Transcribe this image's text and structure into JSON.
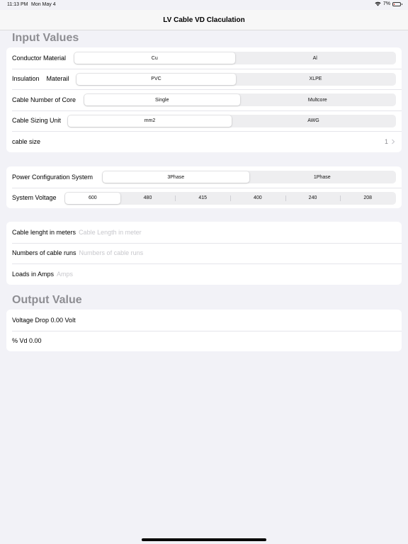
{
  "status": {
    "time": "11:13 PM",
    "date": "Mon May 4",
    "battery": "7%"
  },
  "nav": {
    "title": "LV Cable VD Claculation"
  },
  "input_section": {
    "header": "Input Values",
    "conductor": {
      "label": "Conductor Material",
      "options": [
        "Cu",
        "Al"
      ],
      "selected": 0
    },
    "insulation": {
      "label": "Insulation    Materail",
      "options": [
        "PVC",
        "XLPE"
      ],
      "selected": 0
    },
    "cores": {
      "label": "Cable Number of Core",
      "options": [
        "Single",
        "Multcore"
      ],
      "selected": 0
    },
    "unit": {
      "label": "Cable Sizing Unit",
      "options": [
        "mm2",
        "AWG"
      ],
      "selected": 0
    },
    "size": {
      "label": "cable size",
      "value": "1"
    }
  },
  "power_section": {
    "config": {
      "label": "Power Configuration System",
      "options": [
        "3Phase",
        "1Phase"
      ],
      "selected": 0
    },
    "voltage": {
      "label": "System Voltage",
      "options": [
        "600",
        "480",
        "415",
        "400",
        "240",
        "208"
      ],
      "selected": 0
    }
  },
  "length_section": {
    "length": {
      "label": "Cable lenght in meters",
      "placeholder": "Cable Length in meter"
    },
    "runs": {
      "label": "Numbers of cable runs",
      "placeholder": "Numbers of cable runs"
    },
    "loads": {
      "label": "Loads in Amps",
      "placeholder": "Amps"
    }
  },
  "output_section": {
    "header": "Output Value",
    "voltage_drop": "Voltage Drop 0.00 Volt",
    "percent_vd": "% Vd 0.00"
  }
}
